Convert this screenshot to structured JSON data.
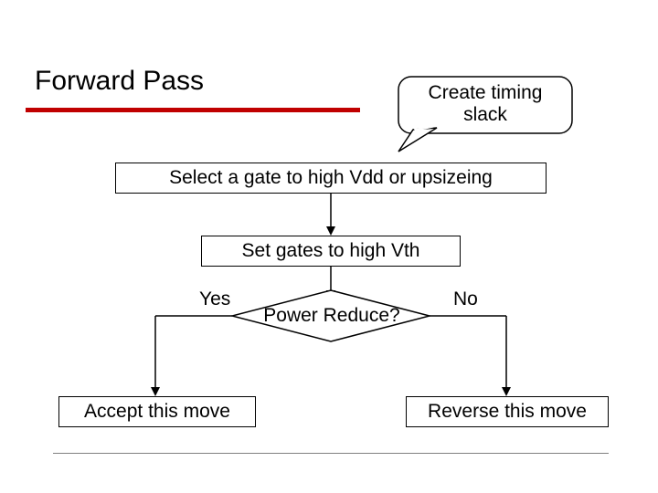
{
  "title": "Forward Pass",
  "callout": {
    "line1": "Create timing",
    "line2": "slack"
  },
  "boxes": {
    "select_gate": "Select a gate to high Vdd or upsizeing",
    "set_gates": "Set gates to high Vth",
    "accept": "Accept this move",
    "reverse": "Reverse this move"
  },
  "decision": "Power Reduce?",
  "branches": {
    "yes": "Yes",
    "no": "No"
  },
  "colors": {
    "accent": "#c00000",
    "outline": "#000000",
    "callout_fill": "#ffffff"
  }
}
